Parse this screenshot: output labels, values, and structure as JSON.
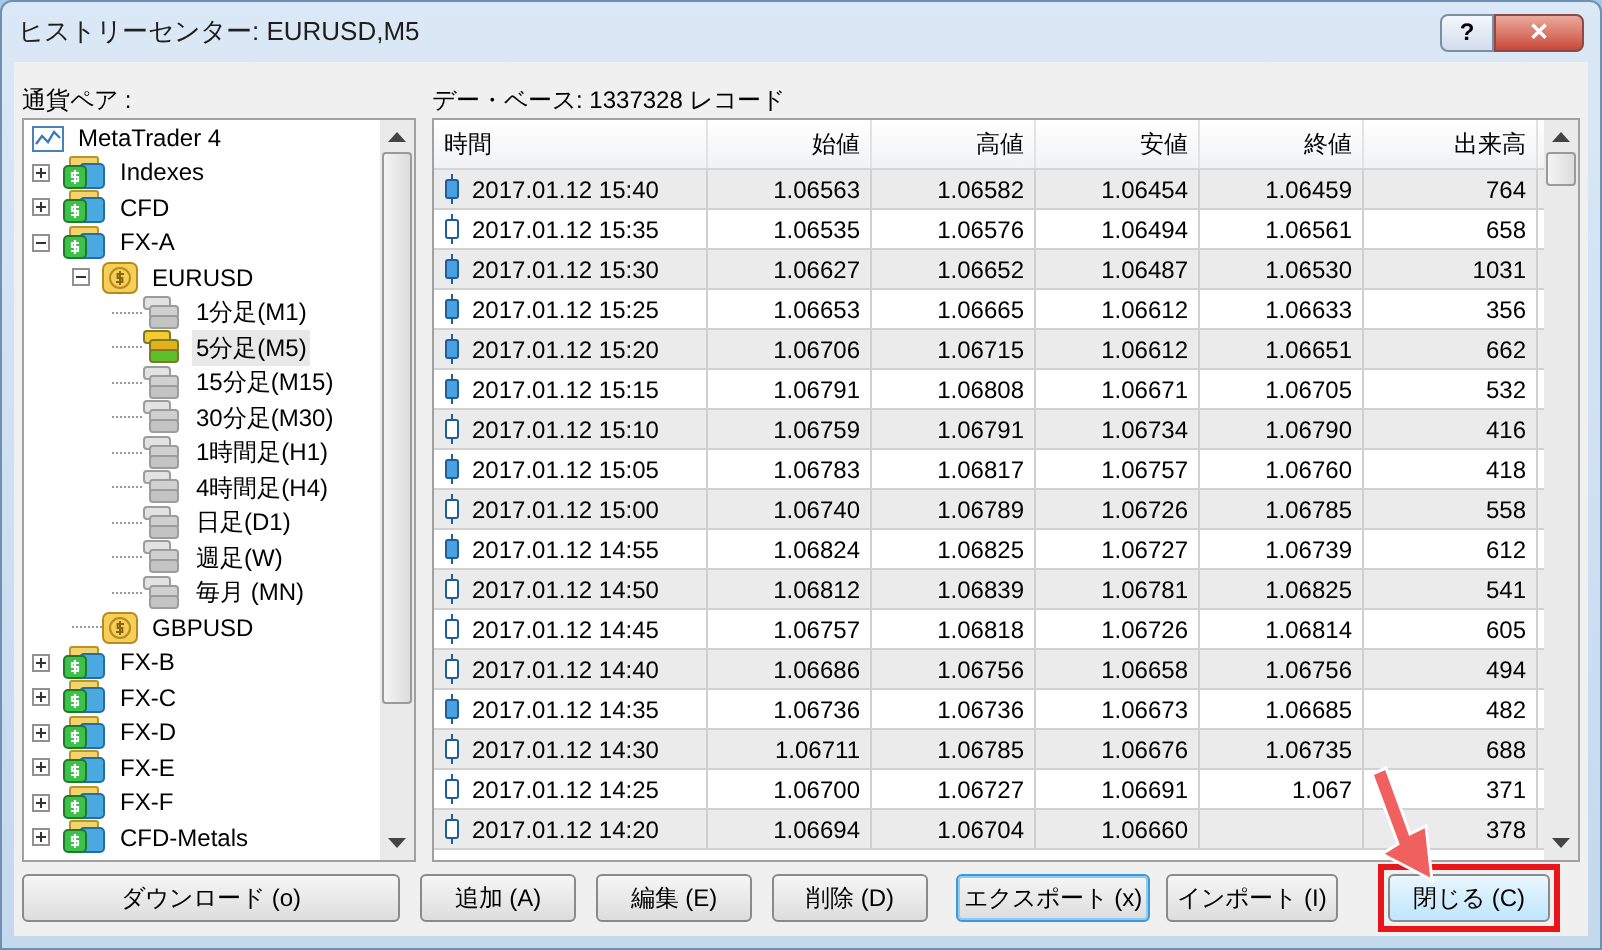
{
  "window": {
    "title": "ヒストリーセンター: EURUSD,M5",
    "help": "?",
    "close": "✕"
  },
  "tree_label": "通貨ペア :",
  "tree": [
    {
      "label": "MetaTrader 4",
      "kind": "root",
      "selected": false,
      "children": [
        {
          "label": "Indexes",
          "kind": "folder",
          "selected": false,
          "expanded": false
        },
        {
          "label": "CFD",
          "kind": "folder",
          "selected": false,
          "expanded": false
        },
        {
          "label": "FX-A",
          "kind": "folder",
          "selected": false,
          "expanded": true,
          "children": [
            {
              "label": "EURUSD",
              "kind": "symbol",
              "selected": false,
              "expanded": true,
              "children": [
                {
                  "label": "1分足(M1)",
                  "kind": "period",
                  "selected": false
                },
                {
                  "label": "5分足(M5)",
                  "kind": "period",
                  "selected": true
                },
                {
                  "label": "15分足(M15)",
                  "kind": "period",
                  "selected": false
                },
                {
                  "label": "30分足(M30)",
                  "kind": "period",
                  "selected": false
                },
                {
                  "label": "1時間足(H1)",
                  "kind": "period",
                  "selected": false
                },
                {
                  "label": "4時間足(H4)",
                  "kind": "period",
                  "selected": false
                },
                {
                  "label": "日足(D1)",
                  "kind": "period",
                  "selected": false
                },
                {
                  "label": "週足(W)",
                  "kind": "period",
                  "selected": false
                },
                {
                  "label": "毎月 (MN)",
                  "kind": "period",
                  "selected": false
                }
              ]
            },
            {
              "label": "GBPUSD",
              "kind": "symbol",
              "selected": false
            }
          ]
        },
        {
          "label": "FX-B",
          "kind": "folder",
          "selected": false,
          "expanded": false
        },
        {
          "label": "FX-C",
          "kind": "folder",
          "selected": false,
          "expanded": false
        },
        {
          "label": "FX-D",
          "kind": "folder",
          "selected": false,
          "expanded": false
        },
        {
          "label": "FX-E",
          "kind": "folder",
          "selected": false,
          "expanded": false
        },
        {
          "label": "FX-F",
          "kind": "folder",
          "selected": false,
          "expanded": false
        },
        {
          "label": "CFD-Metals",
          "kind": "folder",
          "selected": false,
          "expanded": false
        }
      ]
    }
  ],
  "database_label": "デー・ベース: 1337328 レコード",
  "table": {
    "columns": [
      "時間",
      "始値",
      "高値",
      "安値",
      "終値",
      "出来高"
    ],
    "rows": [
      {
        "filled": true,
        "cells": [
          "2017.01.12 15:40",
          "1.06563",
          "1.06582",
          "1.06454",
          "1.06459",
          "764"
        ]
      },
      {
        "filled": false,
        "cells": [
          "2017.01.12 15:35",
          "1.06535",
          "1.06576",
          "1.06494",
          "1.06561",
          "658"
        ]
      },
      {
        "filled": true,
        "cells": [
          "2017.01.12 15:30",
          "1.06627",
          "1.06652",
          "1.06487",
          "1.06530",
          "1031"
        ]
      },
      {
        "filled": true,
        "cells": [
          "2017.01.12 15:25",
          "1.06653",
          "1.06665",
          "1.06612",
          "1.06633",
          "356"
        ]
      },
      {
        "filled": true,
        "cells": [
          "2017.01.12 15:20",
          "1.06706",
          "1.06715",
          "1.06612",
          "1.06651",
          "662"
        ]
      },
      {
        "filled": true,
        "cells": [
          "2017.01.12 15:15",
          "1.06791",
          "1.06808",
          "1.06671",
          "1.06705",
          "532"
        ]
      },
      {
        "filled": false,
        "cells": [
          "2017.01.12 15:10",
          "1.06759",
          "1.06791",
          "1.06734",
          "1.06790",
          "416"
        ]
      },
      {
        "filled": true,
        "cells": [
          "2017.01.12 15:05",
          "1.06783",
          "1.06817",
          "1.06757",
          "1.06760",
          "418"
        ]
      },
      {
        "filled": false,
        "cells": [
          "2017.01.12 15:00",
          "1.06740",
          "1.06789",
          "1.06726",
          "1.06785",
          "558"
        ]
      },
      {
        "filled": true,
        "cells": [
          "2017.01.12 14:55",
          "1.06824",
          "1.06825",
          "1.06727",
          "1.06739",
          "612"
        ]
      },
      {
        "filled": false,
        "cells": [
          "2017.01.12 14:50",
          "1.06812",
          "1.06839",
          "1.06781",
          "1.06825",
          "541"
        ]
      },
      {
        "filled": false,
        "cells": [
          "2017.01.12 14:45",
          "1.06757",
          "1.06818",
          "1.06726",
          "1.06814",
          "605"
        ]
      },
      {
        "filled": false,
        "cells": [
          "2017.01.12 14:40",
          "1.06686",
          "1.06756",
          "1.06658",
          "1.06756",
          "494"
        ]
      },
      {
        "filled": true,
        "cells": [
          "2017.01.12 14:35",
          "1.06736",
          "1.06736",
          "1.06673",
          "1.06685",
          "482"
        ]
      },
      {
        "filled": false,
        "cells": [
          "2017.01.12 14:30",
          "1.06711",
          "1.06785",
          "1.06676",
          "1.06735",
          "688"
        ]
      },
      {
        "filled": false,
        "cells": [
          "2017.01.12 14:25",
          "1.06700",
          "1.06727",
          "1.06691",
          "1.067",
          "371"
        ]
      },
      {
        "filled": false,
        "cells": [
          "2017.01.12 14:20",
          "1.06694",
          "1.06704",
          "1.06660",
          null,
          "378"
        ]
      }
    ]
  },
  "buttons": [
    {
      "label": "ダウンロード (o)",
      "focused": false,
      "highlighted": false
    },
    {
      "label": "追加 (A)",
      "focused": false,
      "highlighted": false
    },
    {
      "label": "編集 (E)",
      "focused": false,
      "highlighted": false
    },
    {
      "label": "削除 (D)",
      "focused": false,
      "highlighted": false
    },
    {
      "label": "エクスポート (x)",
      "focused": true,
      "highlighted": false
    },
    {
      "label": "インポート (I)",
      "focused": false,
      "highlighted": false
    },
    {
      "label": "閉じる (C)",
      "focused": false,
      "highlighted": true
    }
  ]
}
